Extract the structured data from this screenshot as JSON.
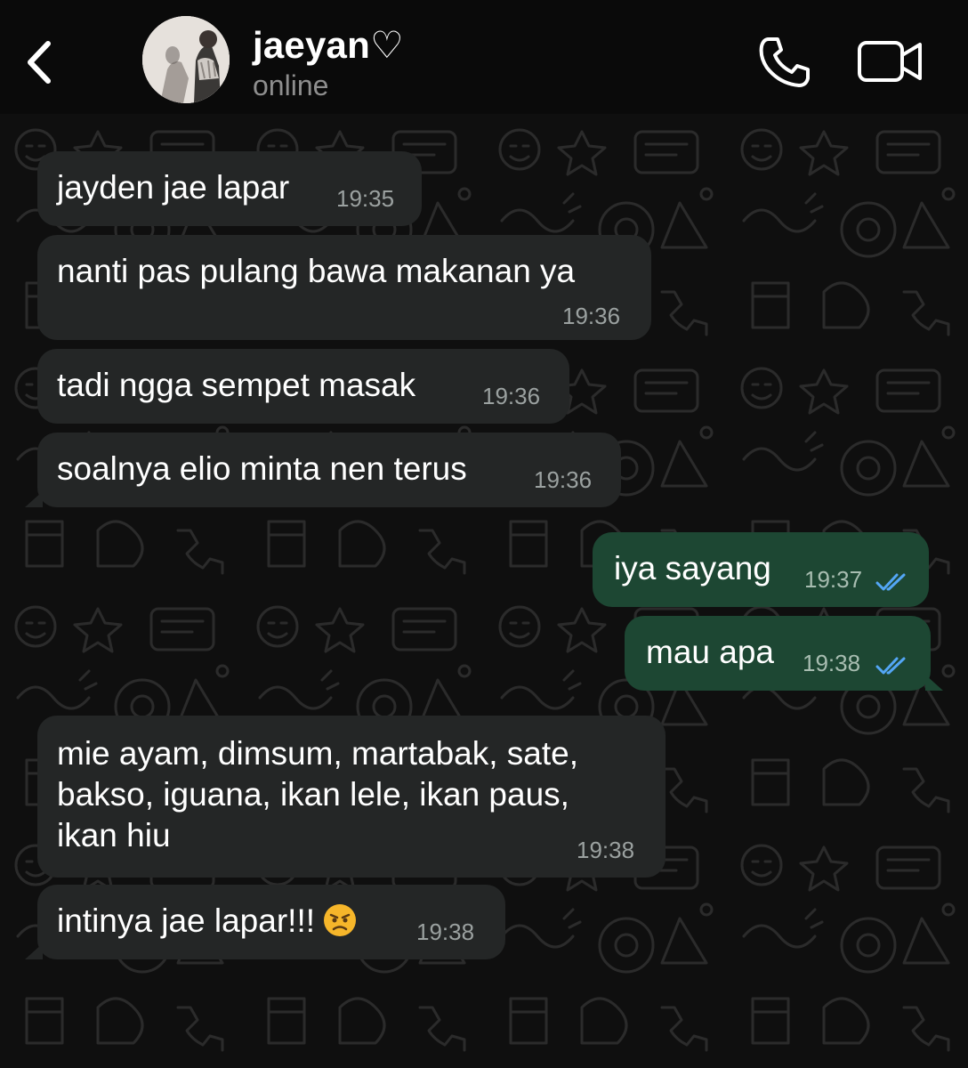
{
  "header": {
    "back_icon": "chevron-left-icon",
    "contact_name": "jaeyan♡",
    "status": "online",
    "call_icon": "phone-icon",
    "video_icon": "video-camera-icon"
  },
  "colors": {
    "incoming_bubble": "#242626",
    "outgoing_bubble": "#1d4733",
    "read_ticks": "#53a6f5",
    "background": "#0f0f0f"
  },
  "messages": [
    {
      "direction": "in",
      "text": "jayden jae lapar",
      "time": "19:35"
    },
    {
      "direction": "in",
      "text": "nanti pas pulang bawa makanan ya",
      "time": "19:36"
    },
    {
      "direction": "in",
      "text": "tadi ngga sempet masak",
      "time": "19:36"
    },
    {
      "direction": "in",
      "text": "soalnya elio minta nen terus",
      "time": "19:36"
    },
    {
      "direction": "out",
      "text": "iya sayang",
      "time": "19:37",
      "status": "read"
    },
    {
      "direction": "out",
      "text": "mau apa",
      "time": "19:38",
      "status": "read"
    },
    {
      "direction": "in",
      "lines": [
        "mie ayam, dimsum, martabak, sate,",
        "bakso, iguana, ikan lele, ikan paus,",
        "ikan hiu"
      ],
      "time": "19:38"
    },
    {
      "direction": "in",
      "text": "intinya jae lapar!!!",
      "emoji": "angry-face-icon",
      "time": "19:38"
    }
  ]
}
